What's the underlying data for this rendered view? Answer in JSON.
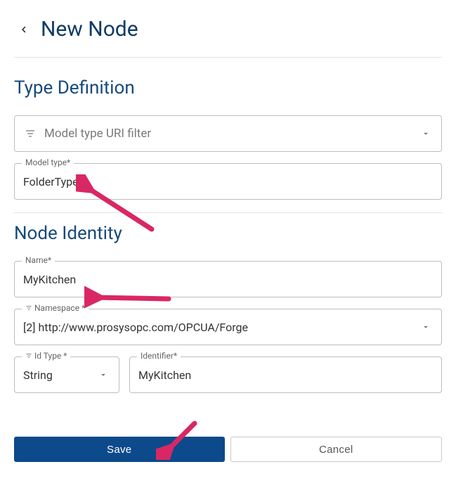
{
  "header": {
    "title": "New Node"
  },
  "section1": {
    "title": "Type Definition",
    "filter_placeholder": "Model type URI filter",
    "model_type_label": "Model type*",
    "model_type_value": "FolderType"
  },
  "section2": {
    "title": "Node Identity",
    "name_label": "Name*",
    "name_value": "MyKitchen",
    "namespace_label": "Namespace *",
    "namespace_value": "[2] http://www.prosysopc.com/OPCUA/Forge",
    "idtype_label": "Id Type *",
    "idtype_value": "String",
    "identifier_label": "Identifier*",
    "identifier_value": "MyKitchen"
  },
  "buttons": {
    "save": "Save",
    "cancel": "Cancel"
  },
  "colors": {
    "heading": "#174a7c",
    "primary_btn": "#0c4a8b",
    "arrow": "#d92765"
  }
}
